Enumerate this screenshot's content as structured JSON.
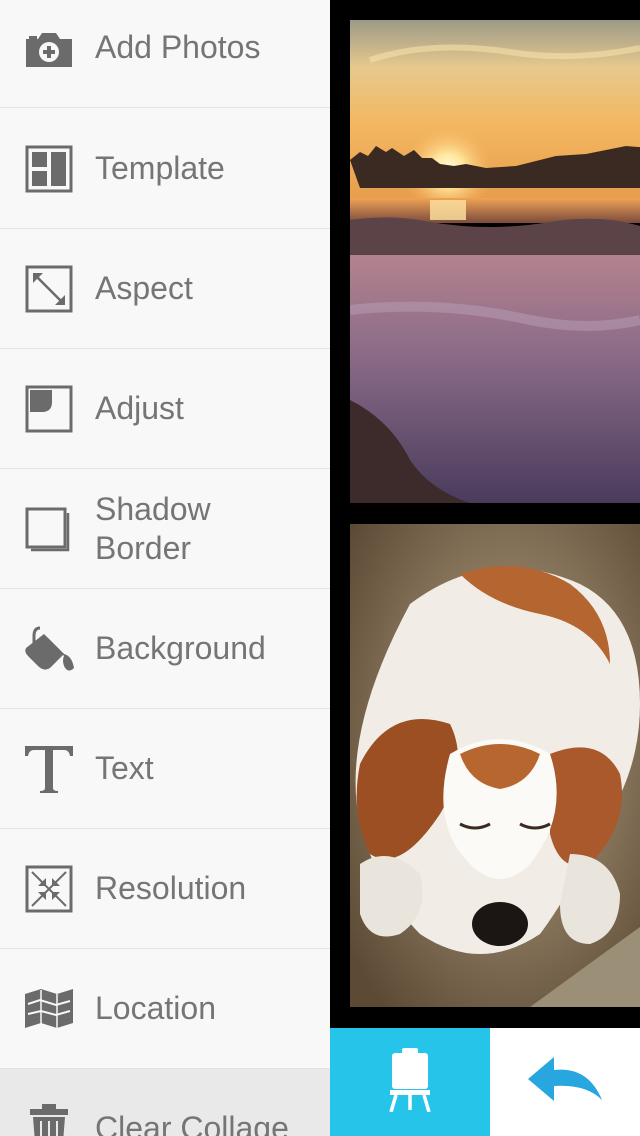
{
  "menu": {
    "items": [
      {
        "label": "Add Photos",
        "icon": "camera-plus-icon"
      },
      {
        "label": "Template",
        "icon": "template-grid-icon"
      },
      {
        "label": "Aspect",
        "icon": "aspect-resize-icon"
      },
      {
        "label": "Adjust",
        "icon": "adjust-corner-icon"
      },
      {
        "label": "Shadow\nBorder",
        "icon": "shadow-border-icon"
      },
      {
        "label": "Background",
        "icon": "paint-bucket-icon"
      },
      {
        "label": "Text",
        "icon": "text-t-icon"
      },
      {
        "label": "Resolution",
        "icon": "resolution-icon"
      },
      {
        "label": "Location",
        "icon": "map-icon"
      },
      {
        "label": "Clear Collage",
        "icon": "trash-icon"
      }
    ]
  },
  "collage": {
    "photos": [
      {
        "subject": "sunset over lake"
      },
      {
        "subject": "sleeping dog"
      }
    ]
  },
  "bottom_bar": {
    "left_icon": "easel-icon",
    "right_icon": "undo-arrow-icon"
  },
  "colors": {
    "accent": "#27c4ea",
    "menu_bg": "#f8f8f8",
    "menu_text": "#757575",
    "icon": "#6b6b6b",
    "undo_arrow": "#27a6e0"
  }
}
